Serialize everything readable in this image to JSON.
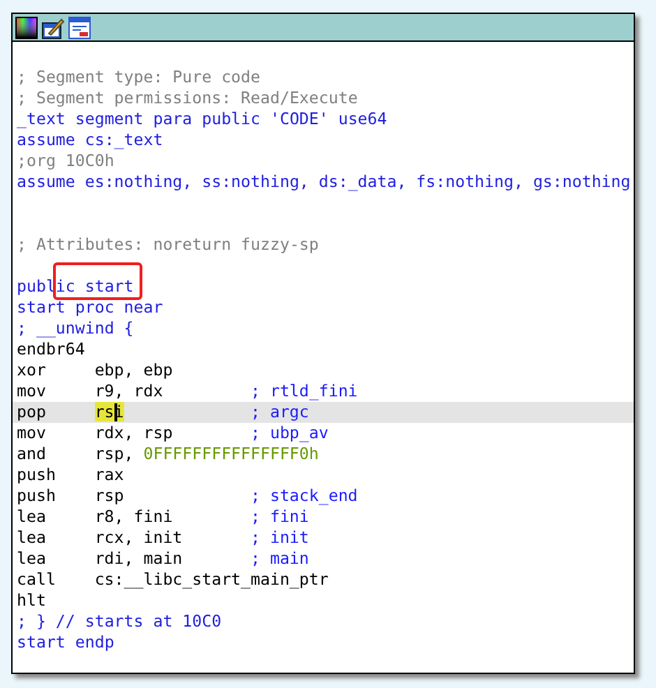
{
  "lines": [
    {
      "kind": "blank"
    },
    {
      "kind": "comment",
      "text": "; Segment type: Pure code"
    },
    {
      "kind": "comment",
      "text": "; Segment permissions: Read/Execute"
    },
    {
      "kind": "directive",
      "text": "_text segment para public 'CODE' use64"
    },
    {
      "kind": "directive",
      "text": "assume cs:_text"
    },
    {
      "kind": "comment",
      "text": ";org 10C0h"
    },
    {
      "kind": "directive",
      "text": "assume es:nothing, ss:nothing, ds:_data, fs:nothing, gs:nothing"
    },
    {
      "kind": "blank"
    },
    {
      "kind": "blank"
    },
    {
      "kind": "comment",
      "text": "; Attributes: noreturn fuzzy-sp"
    },
    {
      "kind": "blank"
    },
    {
      "kind": "directive",
      "text": "public start",
      "outlined": true
    },
    {
      "kind": "directive",
      "text": "start proc near"
    },
    {
      "kind": "directive",
      "text": "; __unwind {"
    },
    {
      "kind": "instr",
      "mnemonic": "endbr64"
    },
    {
      "kind": "instr",
      "mnemonic": "xor",
      "operands": "ebp, ebp"
    },
    {
      "kind": "instr",
      "mnemonic": "mov",
      "operands": "r9, rdx",
      "comment": "; rtld_fini"
    },
    {
      "kind": "instr",
      "mnemonic": "pop",
      "operands": "rsi",
      "comment": "; argc",
      "selected": true,
      "highlighted": true
    },
    {
      "kind": "instr",
      "mnemonic": "mov",
      "operands": "rdx, rsp",
      "comment": "; ubp_av"
    },
    {
      "kind": "instr",
      "mnemonic": "and",
      "operands": "rsp, ",
      "number": "0FFFFFFFFFFFFFFF0h"
    },
    {
      "kind": "instr",
      "mnemonic": "push",
      "operands": "rax"
    },
    {
      "kind": "instr",
      "mnemonic": "push",
      "operands": "rsp",
      "comment": "; stack_end"
    },
    {
      "kind": "instr",
      "mnemonic": "lea",
      "operands": "r8, fini",
      "comment": "; fini"
    },
    {
      "kind": "instr",
      "mnemonic": "lea",
      "operands": "rcx, init",
      "comment": "; init"
    },
    {
      "kind": "instr",
      "mnemonic": "lea",
      "operands": "rdi, main",
      "comment": "; main"
    },
    {
      "kind": "instr",
      "mnemonic": "call",
      "operands": "cs:__libc_start_main_ptr"
    },
    {
      "kind": "instr",
      "mnemonic": "hlt"
    },
    {
      "kind": "directive",
      "text": "; } // starts at 10C0"
    },
    {
      "kind": "directive",
      "text": "start endp"
    }
  ]
}
